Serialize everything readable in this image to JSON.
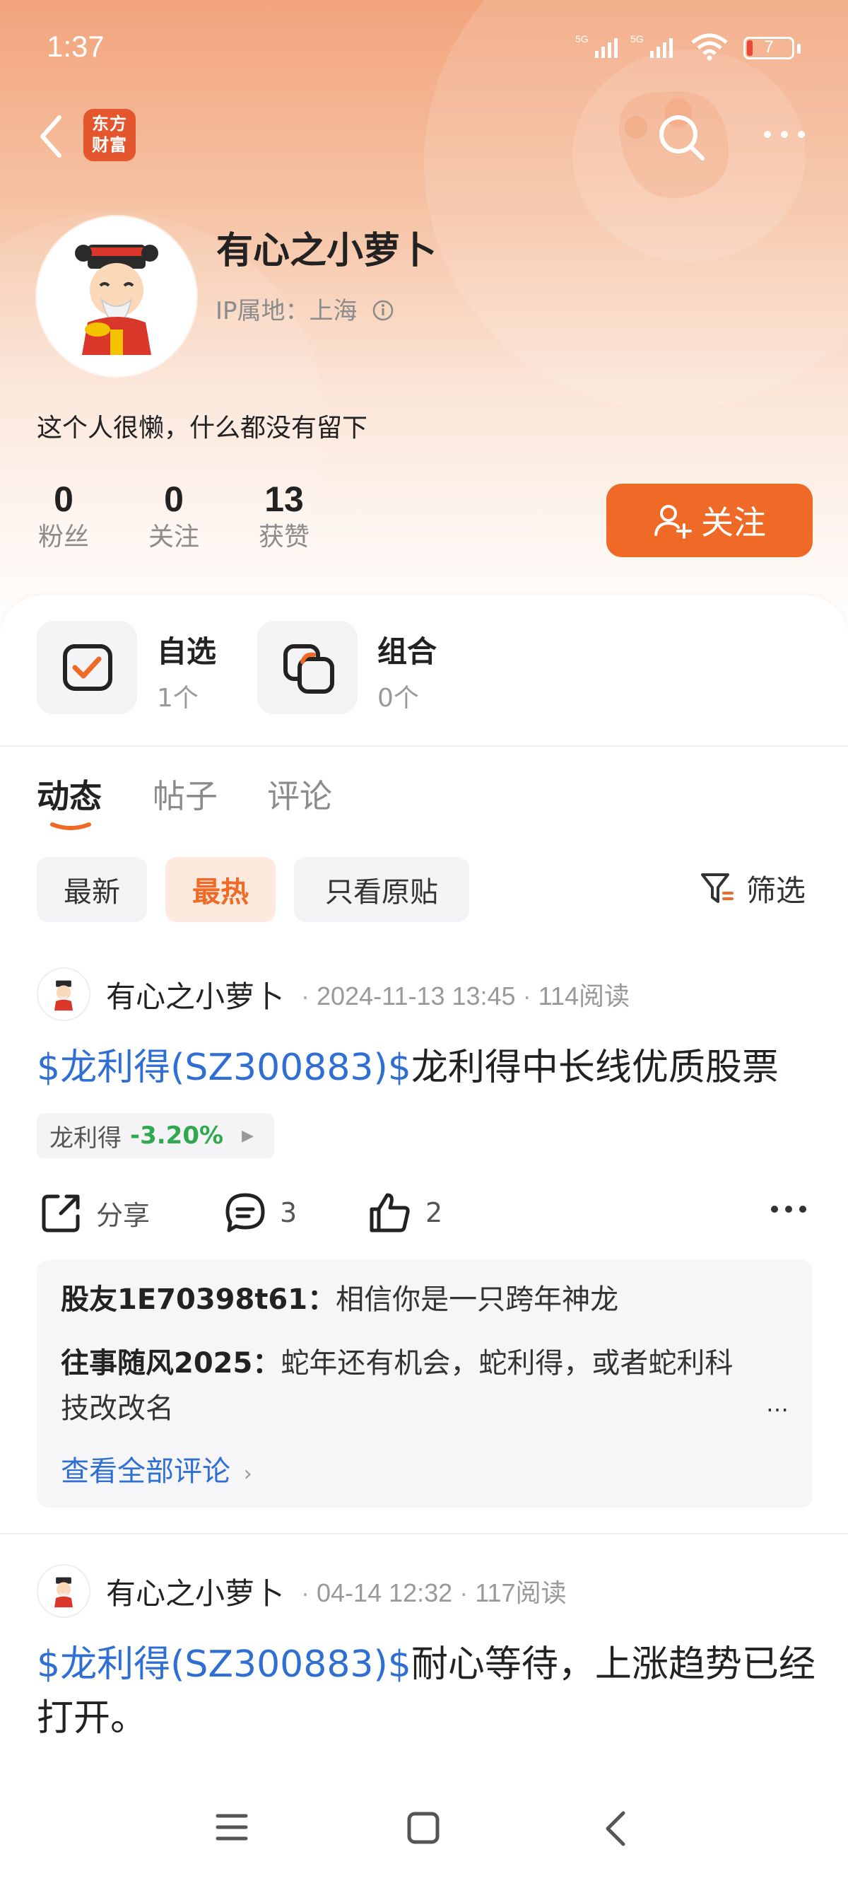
{
  "status_bar": {
    "time": "1:37",
    "battery": "7"
  },
  "header": {
    "app_logo_text": "东方财富"
  },
  "profile": {
    "name": "有心之小萝卜",
    "ip_location": "IP属地：上海",
    "bio": "这个人很懒，什么都没有留下",
    "stats": [
      {
        "value": "0",
        "label": "粉丝"
      },
      {
        "value": "0",
        "label": "关注"
      },
      {
        "value": "13",
        "label": "获赞"
      }
    ],
    "follow_label": "关注"
  },
  "quick_links": [
    {
      "title": "自选",
      "sub": "1个"
    },
    {
      "title": "组合",
      "sub": "0个"
    }
  ],
  "tabs": [
    "动态",
    "帖子",
    "评论"
  ],
  "filters": {
    "chips": [
      "最新",
      "最热",
      "只看原贴"
    ],
    "filter_label": "筛选"
  },
  "posts": [
    {
      "author": "有心之小萝卜",
      "date": "2024-11-13 13:45",
      "reads": "114阅读",
      "stock_link": "$龙利得(SZ300883)$",
      "text": "龙利得中长线优质股票",
      "tag_name": "龙利得",
      "tag_change": "-3.20%",
      "actions": {
        "share": "分享",
        "comments": "3",
        "likes": "2"
      },
      "comments": [
        {
          "user": "股友1E70398t61：",
          "text": "相信你是一只跨年神龙"
        },
        {
          "user": "往事随风2025：",
          "text": "蛇年还有机会，蛇利得，或者蛇利科技改改名"
        }
      ],
      "more_comments": "查看全部评论"
    },
    {
      "author": "有心之小萝卜",
      "date": "04-14 12:32",
      "reads": "117阅读",
      "stock_link": "$龙利得(SZ300883)$",
      "text": "耐心等待，上涨趋势已经打开。"
    }
  ],
  "colors": {
    "accent": "#ef6a26",
    "link": "#2f6fd4",
    "down": "#2fa84f"
  }
}
